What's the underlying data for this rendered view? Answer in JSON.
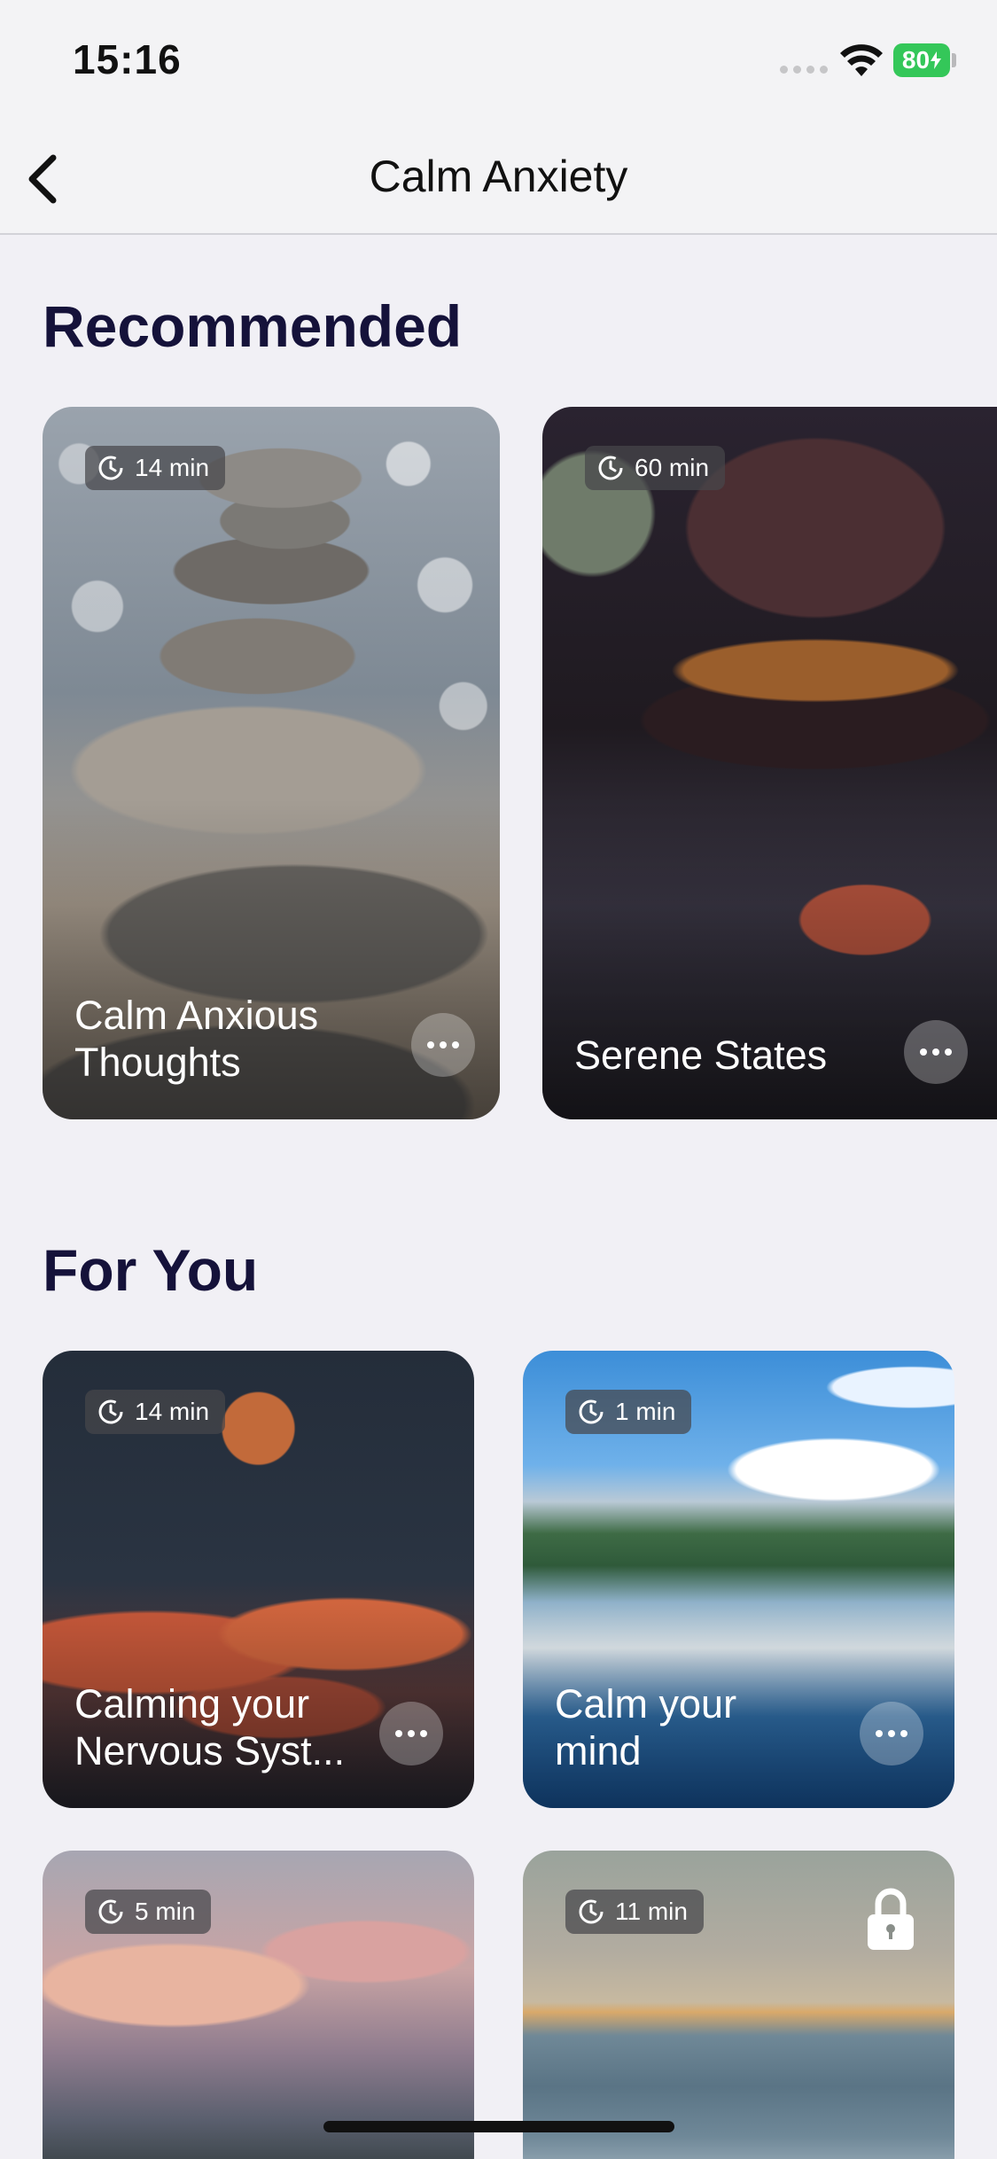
{
  "status_bar": {
    "time": "15:16",
    "battery": "80"
  },
  "nav": {
    "title": "Calm Anxiety"
  },
  "sections": {
    "recommended": "Recommended",
    "for_you": "For You"
  },
  "recommended_cards": [
    {
      "duration": "14 min",
      "title": "Calm Anxious Thoughts"
    },
    {
      "duration": "60 min",
      "title": "Serene States"
    }
  ],
  "for_you_cards": [
    {
      "duration": "14 min",
      "title": "Calming your Nervous Syst..."
    },
    {
      "duration": "1 min",
      "title": "Calm your mind"
    },
    {
      "duration": "5 min",
      "title": ""
    },
    {
      "duration": "11 min",
      "title": "",
      "locked": true
    }
  ],
  "colors": {
    "background": "#f1f0f5",
    "heading": "#15123a",
    "battery": "#34c759"
  }
}
